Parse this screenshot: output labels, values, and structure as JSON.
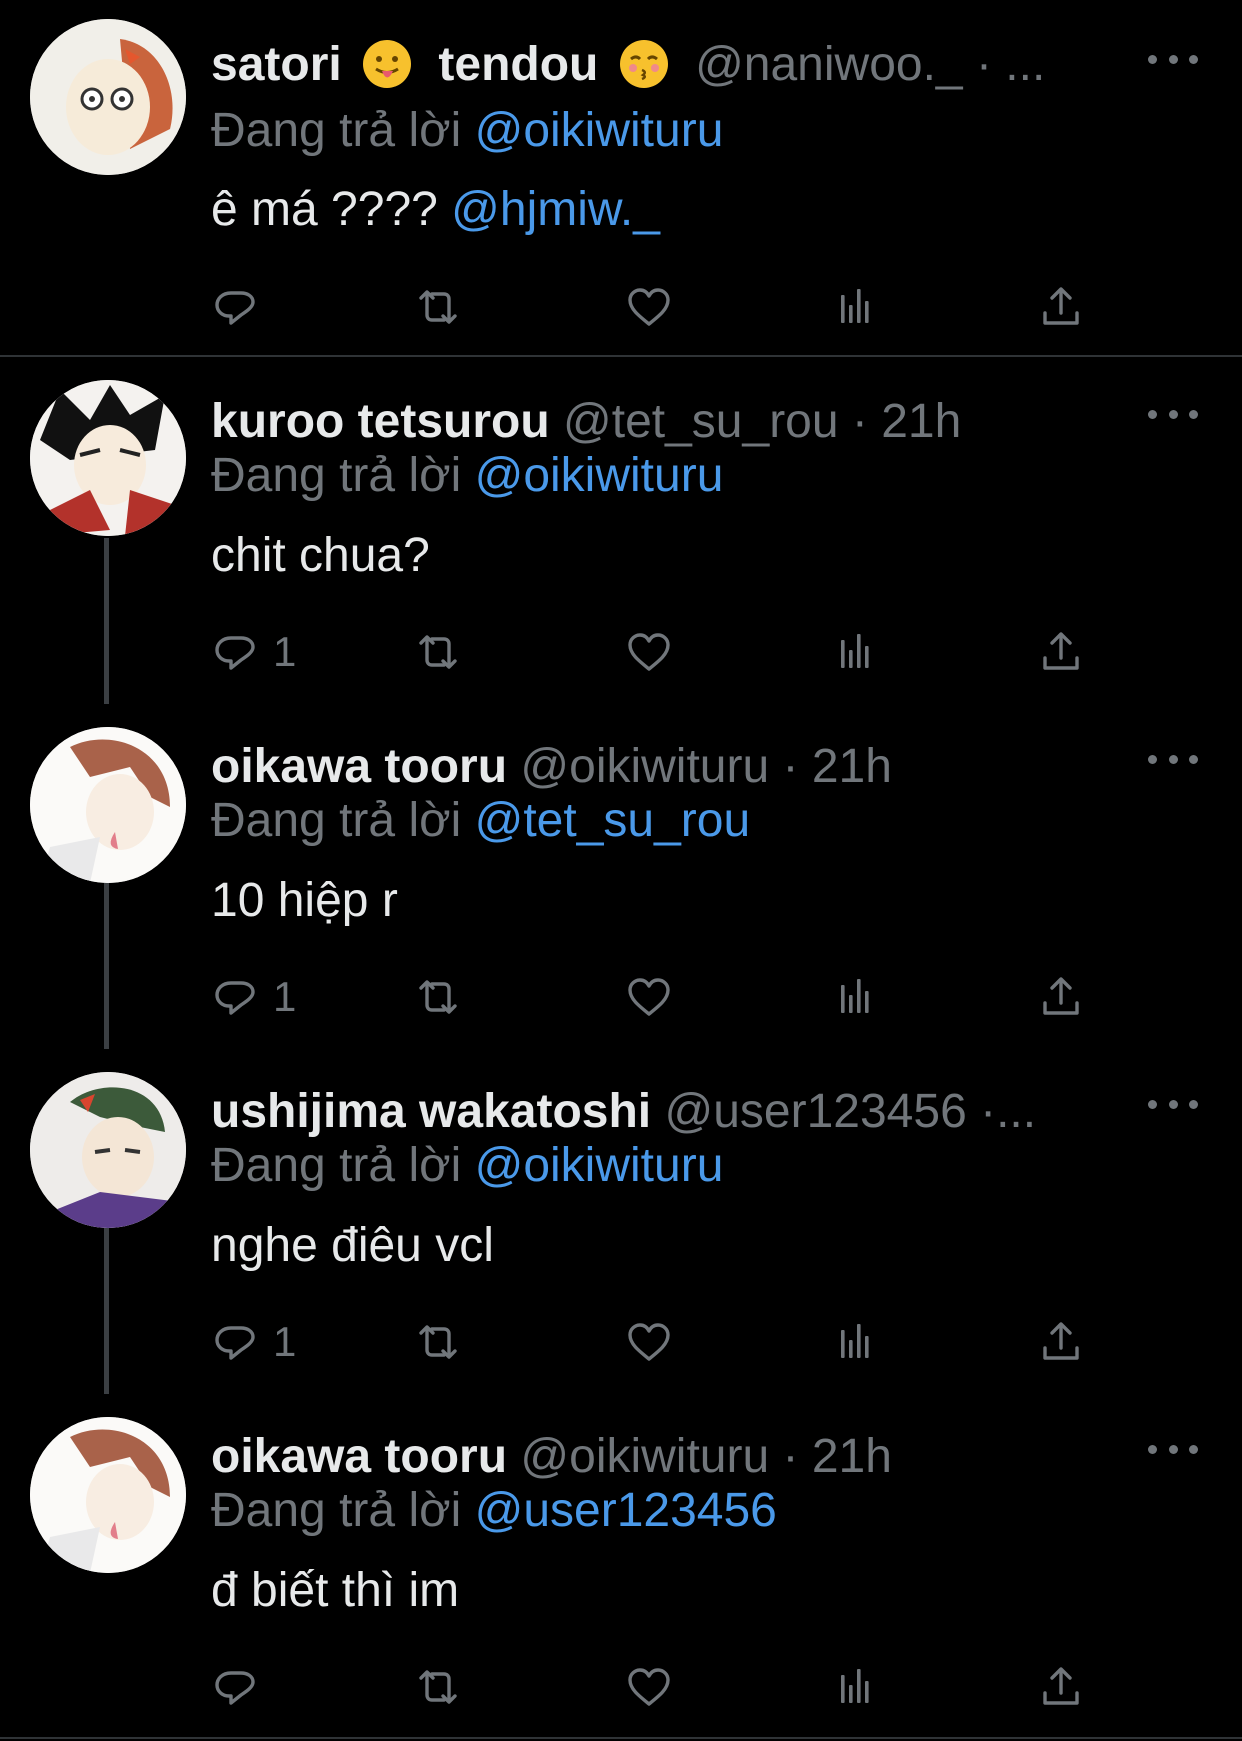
{
  "tweets": [
    {
      "display_name_1": "satori",
      "display_name_2": "tendou",
      "emoji_1": "tongue-emoji",
      "emoji_2": "kissing-emoji",
      "handle": "@naniwoo._ · ...",
      "replying_label": "Đang trả lời",
      "replying_to": "@oikiwituru",
      "text_prefix": "ê má ????",
      "text_mention": "@hjmiw._",
      "counts": {
        "reply": ""
      }
    },
    {
      "display_name": "kuroo tetsurou",
      "handle": "@tet_su_rou · 21h",
      "replying_label": "Đang trả lời",
      "replying_to": "@oikiwituru",
      "text": "chit chua?",
      "counts": {
        "reply": "1"
      }
    },
    {
      "display_name": "oikawa tooru",
      "handle": "@oikiwituru · 21h",
      "replying_label": "Đang trả lời",
      "replying_to": "@tet_su_rou",
      "text": "10 hiệp r",
      "counts": {
        "reply": "1"
      }
    },
    {
      "display_name": "ushijima wakatoshi",
      "handle": "@user123456 ·...",
      "replying_label": "Đang trả lời",
      "replying_to": "@oikiwituru",
      "text": "nghe điêu vcl",
      "counts": {
        "reply": "1"
      }
    },
    {
      "display_name": "oikawa tooru",
      "handle": "@oikiwituru · 21h",
      "replying_label": "Đang trả lời",
      "replying_to": "@user123456",
      "text": "đ biết thì im",
      "counts": {
        "reply": ""
      }
    }
  ],
  "icons": [
    "reply-icon",
    "retweet-icon",
    "like-icon",
    "views-icon",
    "share-icon",
    "more-icon"
  ],
  "colors": {
    "background": "#000000",
    "text": "#e7e9ea",
    "secondary": "#71767b",
    "mention": "#4a99e9",
    "divider": "#2f3336"
  }
}
